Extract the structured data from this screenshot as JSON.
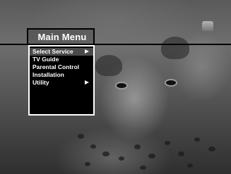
{
  "menu": {
    "title": "Main Menu",
    "items": [
      {
        "label": "Select Service",
        "selected": true,
        "has_submenu": true
      },
      {
        "label": "TV Guide",
        "selected": false,
        "has_submenu": false
      },
      {
        "label": "Parental Control",
        "selected": false,
        "has_submenu": false
      },
      {
        "label": "Installation",
        "selected": false,
        "has_submenu": false
      },
      {
        "label": "Utility",
        "selected": false,
        "has_submenu": true
      }
    ]
  },
  "colors": {
    "menu_background": "#000000",
    "menu_border": "#ffffff",
    "selected_highlight": "#4a4a4a",
    "text": "#ffffff"
  },
  "icons": {
    "submenu": "arrow-right-icon",
    "channel_logo": "channel-logo-icon"
  }
}
